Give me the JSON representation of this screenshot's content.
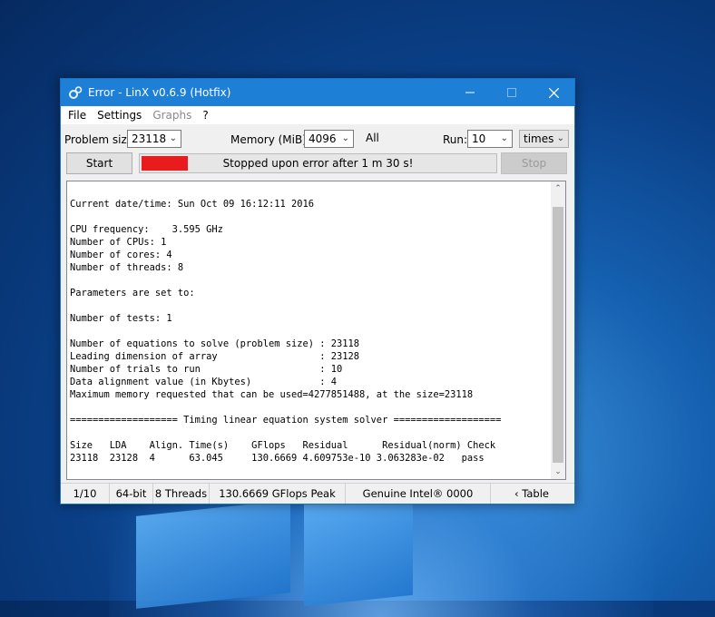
{
  "window": {
    "title": "Error - LinX v0.6.9 (Hotfix)"
  },
  "menu": {
    "items": [
      "File",
      "Settings",
      "Graphs",
      "?"
    ]
  },
  "controls": {
    "problem_size_label": "Problem size:",
    "problem_size_value": "23118",
    "memory_label": "Memory (MiB):",
    "memory_value": "4096",
    "all_label": "All",
    "run_label": "Run:",
    "run_value": "10",
    "run_unit": "times"
  },
  "actions": {
    "start_label": "Start",
    "stop_label": "Stop",
    "progress_text": "Stopped upon error after 1 m 30 s!",
    "progress_fraction": 0.13,
    "progress_color": "#e81c1c"
  },
  "log": {
    "lines": [
      "",
      "Current date/time: Sun Oct 09 16:12:11 2016",
      "",
      "CPU frequency:    3.595 GHz",
      "Number of CPUs: 1",
      "Number of cores: 4",
      "Number of threads: 8",
      "",
      "Parameters are set to:",
      "",
      "Number of tests: 1",
      "",
      "Number of equations to solve (problem size) : 23118",
      "Leading dimension of array                  : 23128",
      "Number of trials to run                     : 10",
      "Data alignment value (in Kbytes)            : 4",
      "Maximum memory requested that can be used=4277851488, at the size=23118",
      "",
      "=================== Timing linear equation system solver ===================",
      "",
      "Size   LDA    Align. Time(s)    GFlops   Residual      Residual(norm) Check",
      "23118  23128  4      63.045     130.6669 4.609753e-10 3.063283e-02   pass"
    ]
  },
  "status": {
    "run_index": "1/10",
    "bits": "64-bit",
    "threads": "8 Threads",
    "peak": "130.6669 GFlops Peak",
    "cpu": "Genuine Intel® 0000",
    "table": "‹ Table"
  }
}
